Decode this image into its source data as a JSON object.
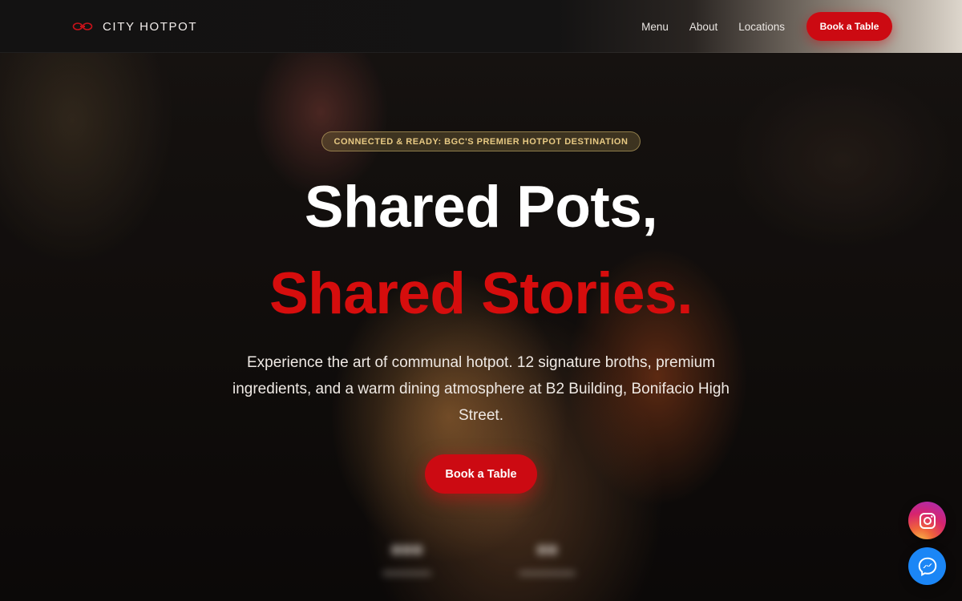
{
  "brand": {
    "name": "CITY HOTPOT",
    "logo_icon": "twin-pot-logo-icon",
    "accent_color": "#cc0a12"
  },
  "nav": {
    "links": [
      "Menu",
      "About",
      "Locations"
    ],
    "cta_label": "Book a Table"
  },
  "hero": {
    "badge": "CONNECTED & READY: BGC'S PREMIER HOTPOT DESTINATION",
    "title_line1": "Shared Pots,",
    "title_line2": "Shared Stories.",
    "title_line2_color": "#d60d0d",
    "description": "Experience the art of communal hotpot. 12 signature broths, premium ingredients, and a warm dining atmosphere at B2 Building, Bonifacio High Street.",
    "cta_label": "Book a Table"
  },
  "socials": [
    {
      "icon": "instagram-icon",
      "color": "#d7246d"
    },
    {
      "icon": "messenger-icon",
      "color": "#1b86f6"
    }
  ]
}
